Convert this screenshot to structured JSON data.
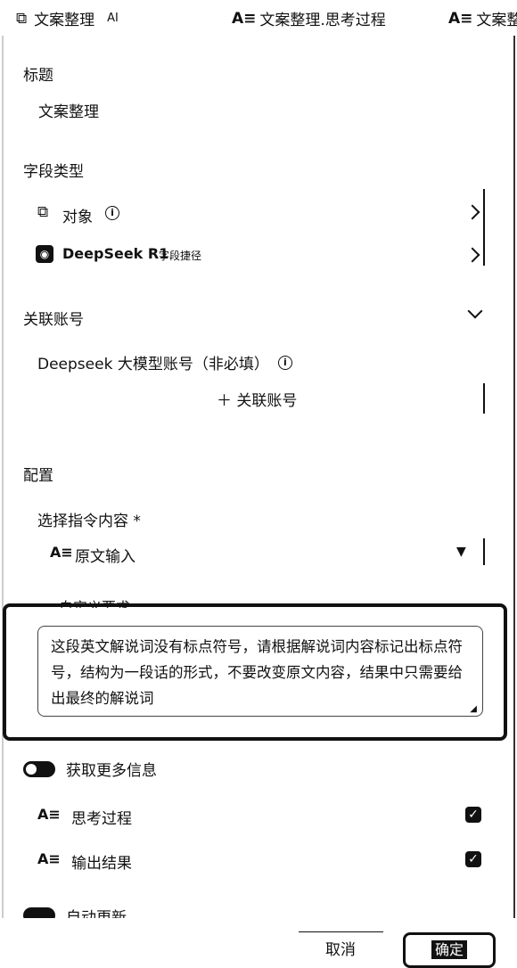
{
  "tabs": [
    {
      "label": "文案整理",
      "badge": "AI"
    },
    {
      "label": "文案整理.思考过程"
    },
    {
      "label": "文案整理"
    }
  ],
  "sections": {
    "title": {
      "label": "标题",
      "value": "文案整理"
    },
    "field_type": {
      "label": "字段类型",
      "object_label": "对象",
      "model_label": "DeepSeek R1",
      "model_tag": "字段捷径"
    },
    "account": {
      "label": "关联账号",
      "item_label": "Deepseek 大模型账号（非必填）",
      "add_label": "＋ 关联账号"
    },
    "config": {
      "label": "配置",
      "instruction_label": "选择指令内容 *",
      "instruction_value": "原文输入",
      "custom_label": "自定义要求",
      "custom_text": "这段英文解说词没有标点符号，请根据解说词内容标记出标点符号，结构为一段话的形式，不要改变原文内容，结果中只需要给出最终的解说词"
    },
    "more_info": {
      "label": "获取更多信息",
      "items": [
        {
          "label": "思考过程"
        },
        {
          "label": "输出结果"
        }
      ]
    },
    "auto_update_label": "自动更新"
  },
  "footer": {
    "cancel_label": "取消",
    "confirm_label": "确定"
  }
}
